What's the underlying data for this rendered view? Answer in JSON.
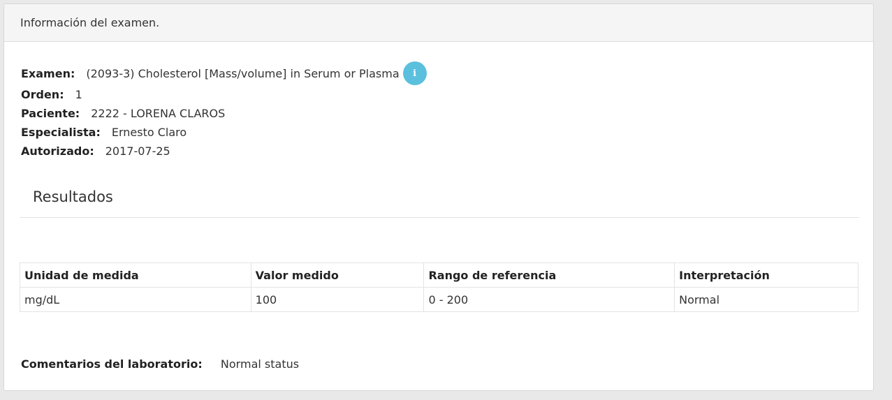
{
  "header": {
    "title": "Información del examen."
  },
  "exam": {
    "examen_label": "Examen:",
    "examen_value": "(2093-3) Cholesterol [Mass/volume] in Serum or Plasma",
    "info_icon_glyph": "i",
    "info_icon_name": "info-icon",
    "orden_label": "Orden:",
    "orden_value": "1",
    "paciente_label": "Paciente:",
    "paciente_value": "2222 - LORENA CLAROS",
    "especialista_label": "Especialista:",
    "especialista_value": "Ernesto Claro",
    "autorizado_label": "Autorizado:",
    "autorizado_value": "2017-07-25"
  },
  "results": {
    "title": "Resultados",
    "columns": [
      "Unidad de medida",
      "Valor medido",
      "Rango de referencia",
      "Interpretación"
    ],
    "rows": [
      [
        "mg/dL",
        "100",
        "0 - 200",
        "Normal"
      ]
    ]
  },
  "comments": {
    "label": "Comentarios del laboratorio:",
    "value": "Normal status"
  },
  "colors": {
    "info_icon_bg": "#5bc0de",
    "header_bg": "#f5f5f6",
    "page_bg": "#e9e9e9"
  }
}
